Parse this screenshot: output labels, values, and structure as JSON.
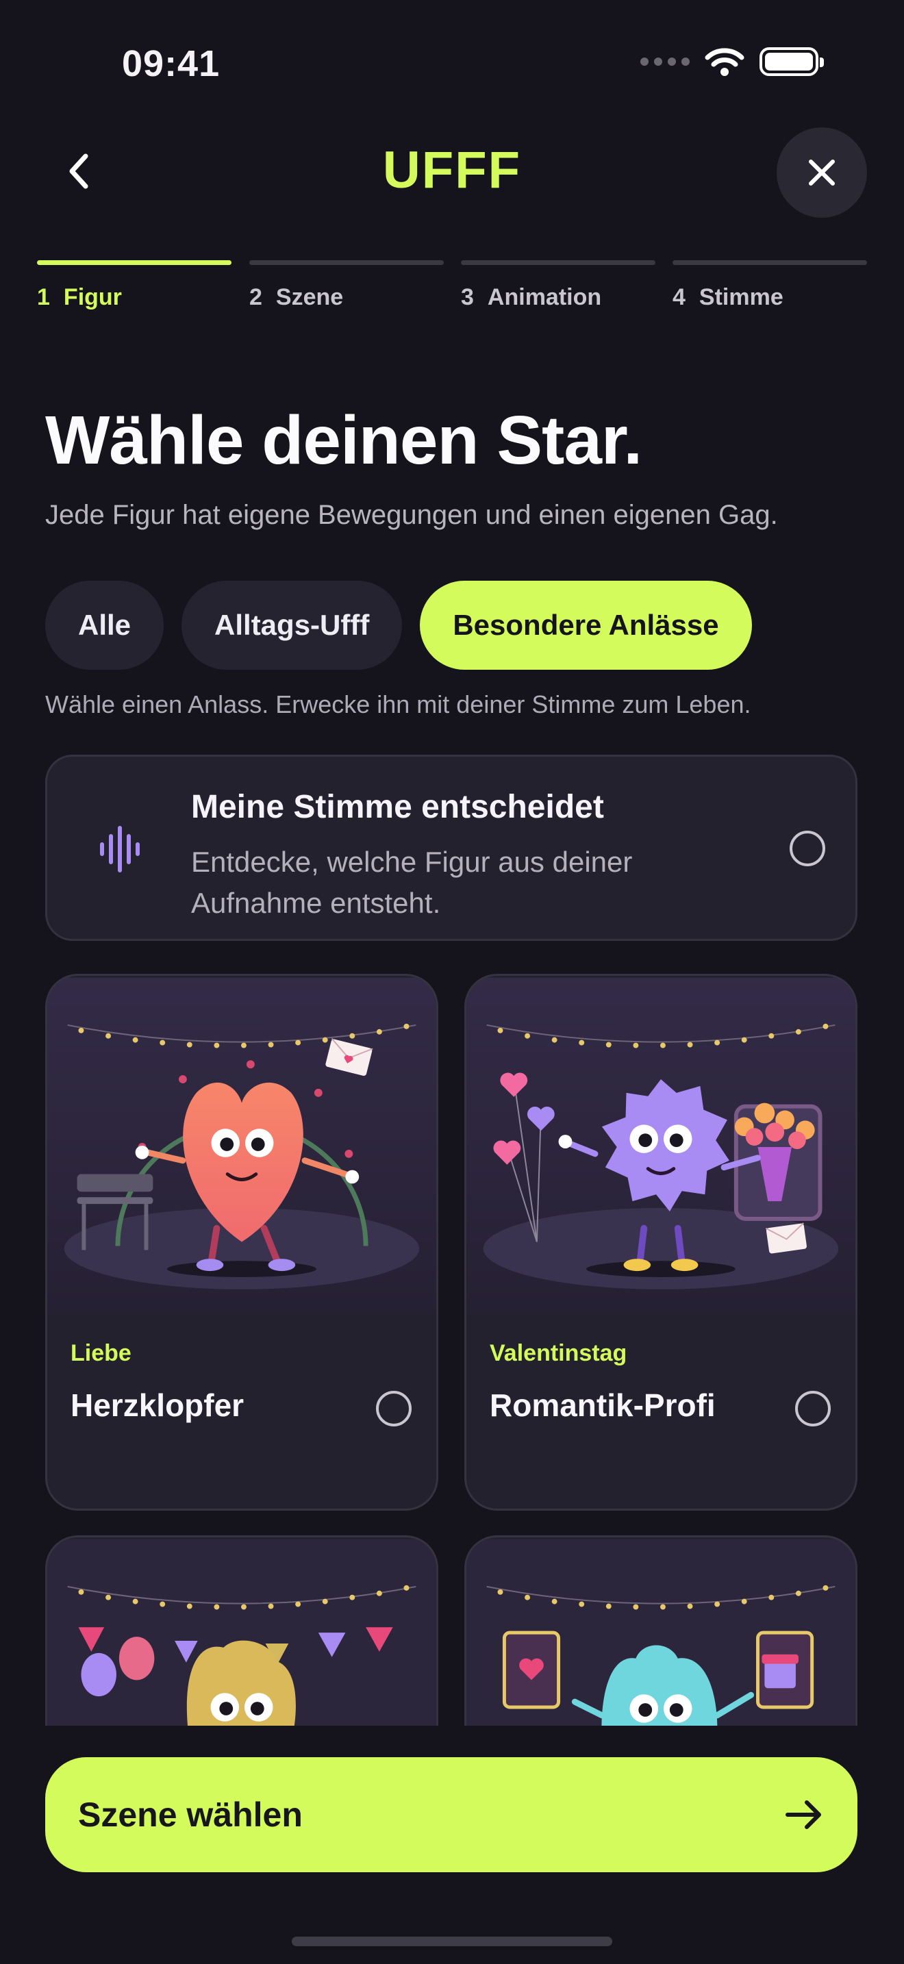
{
  "status_bar": {
    "time": "09:41"
  },
  "header": {
    "brand": "UFFF"
  },
  "stepper": [
    {
      "num": "1",
      "label": "Figur",
      "active": true
    },
    {
      "num": "2",
      "label": "Szene",
      "active": false
    },
    {
      "num": "3",
      "label": "Animation",
      "active": false
    },
    {
      "num": "4",
      "label": "Stimme",
      "active": false
    }
  ],
  "intro": {
    "title": "Wähle deinen Star.",
    "subtitle": "Jede Figur hat eigene Bewegungen und einen eigenen Gag."
  },
  "filters": {
    "chips": [
      {
        "label": "Alle",
        "selected": false
      },
      {
        "label": "Alltags-Ufff",
        "selected": false
      },
      {
        "label": "Besondere Anlässe",
        "selected": true
      }
    ],
    "hint": "Wähle einen Anlass. Erwecke ihn mit deiner Stimme zum Leben."
  },
  "voice_option": {
    "title": "Meine Stimme entscheidet",
    "description": "Entdecke, welche Figur aus deiner Aufnahme entsteht.",
    "icon": "waveform-icon",
    "selected": false
  },
  "characters": [
    {
      "tag": "Liebe",
      "name": "Herzklopfer",
      "selected": false
    },
    {
      "tag": "Valentinstag",
      "name": "Romantik-Profi",
      "selected": false
    },
    {
      "tag": "",
      "name": "",
      "selected": false
    },
    {
      "tag": "",
      "name": "",
      "selected": false
    }
  ],
  "cta": {
    "label": "Szene wählen",
    "icon": "arrow-right-icon"
  },
  "colors": {
    "background": "#15141c",
    "accent": "#d4fb5c",
    "card": "#23212d",
    "heart_char": "#f5835e",
    "star_char": "#a98cf3",
    "cheese_char": "#d9b95a",
    "splash_char": "#6fd6de"
  }
}
